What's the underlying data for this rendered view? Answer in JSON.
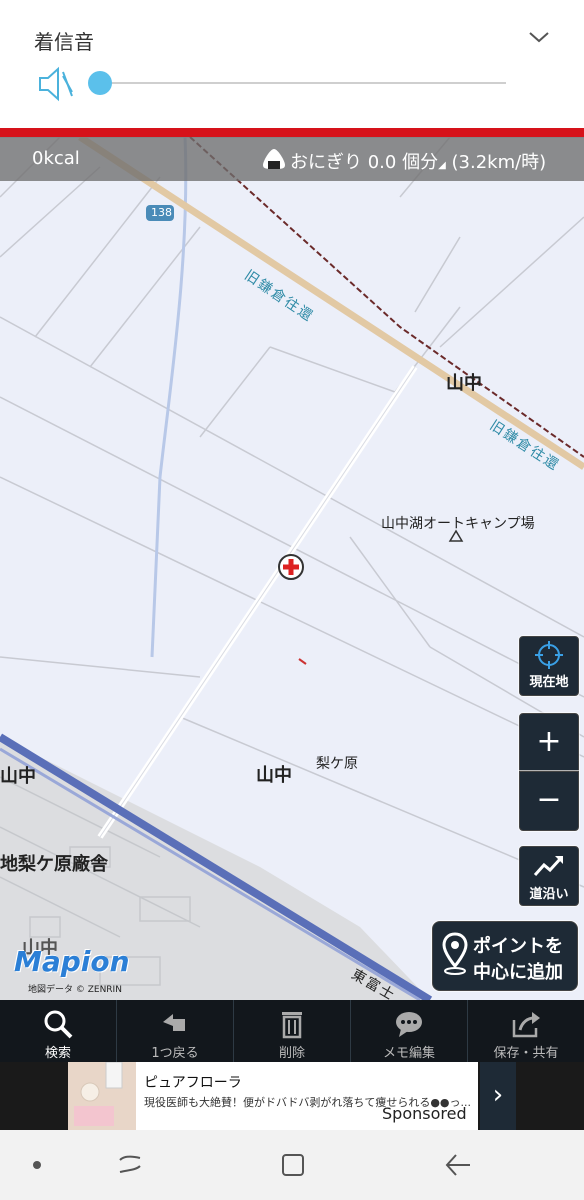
{
  "volume_panel": {
    "title": "着信音",
    "level": 0.0,
    "icons": [
      "mute-icon",
      "chevron-down-icon"
    ]
  },
  "accent_colors": {
    "red_line": "#d6121a",
    "slider": "#5bc0eb",
    "toolbar_bg": "#12171c"
  },
  "map_topbar": {
    "calories": "0kcal",
    "onigiri": "おにぎり 0.0 個分",
    "speed": "(3.2km/時)"
  },
  "map": {
    "route_number": "138",
    "road_name_1": "旧鎌倉往還",
    "road_name_2": "旧鎌倉往還",
    "road_name_3": "東富士",
    "place_yamanaka_1": "山中",
    "place_camp": "山中湖オートキャンプ場",
    "place_yamanaka_2": "山中",
    "place_nashigahara": "梨ケ原",
    "place_yamanaka_3": "山中",
    "place_barracks": "地梨ケ原廠舎",
    "place_cut": "山中",
    "logo": "Mapion",
    "copyright": "地図データ © ZENRIN"
  },
  "map_controls": {
    "current_location": "現在地",
    "zoom_in": "+",
    "zoom_out": "−",
    "along_road": "道沿い",
    "add_point_line1": "ポイントを",
    "add_point_line2": "中心に追加"
  },
  "toolbar": {
    "items": [
      {
        "label": "検索",
        "icon": "search-icon"
      },
      {
        "label": "1つ戻る",
        "icon": "undo-icon"
      },
      {
        "label": "削除",
        "icon": "trash-icon"
      },
      {
        "label": "メモ編集",
        "icon": "memo-icon"
      },
      {
        "label": "保存・共有",
        "icon": "share-icon"
      }
    ]
  },
  "ad": {
    "title": "ピュアフローラ",
    "description": "現役医師も大絶賛！便がドバドバ剥がれ落ちて痩せられる●●っ...",
    "sponsored": "Sponsored",
    "arrow": "›"
  },
  "nav": {
    "icons": [
      "dot-icon",
      "recent-apps-icon",
      "home-icon",
      "back-icon"
    ]
  }
}
